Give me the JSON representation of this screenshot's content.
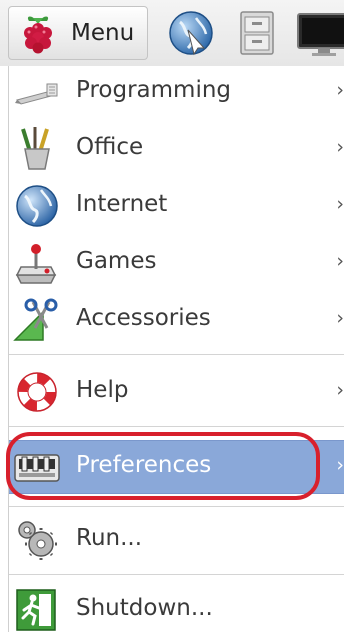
{
  "taskbar": {
    "menu_label": "Menu",
    "launchers": [
      {
        "icon": "web-browser-icon"
      },
      {
        "icon": "file-manager-icon"
      },
      {
        "icon": "terminal-icon"
      }
    ]
  },
  "menu": {
    "items": [
      {
        "label": "Programming",
        "icon": "programming-icon",
        "submenu": true
      },
      {
        "label": "Office",
        "icon": "office-icon",
        "submenu": true
      },
      {
        "label": "Internet",
        "icon": "internet-icon",
        "submenu": true
      },
      {
        "label": "Games",
        "icon": "games-icon",
        "submenu": true
      },
      {
        "label": "Accessories",
        "icon": "accessories-icon",
        "submenu": true
      },
      {
        "label": "Help",
        "icon": "help-icon",
        "submenu": true
      },
      {
        "label": "Preferences",
        "icon": "preferences-icon",
        "submenu": true,
        "selected": true
      },
      {
        "label": "Run...",
        "icon": "run-icon",
        "submenu": false
      },
      {
        "label": "Shutdown...",
        "icon": "shutdown-icon",
        "submenu": false
      }
    ],
    "submenu_arrow": "›",
    "selected_color": "#8aa8d9",
    "highlight_ring_color": "#d8202c"
  }
}
